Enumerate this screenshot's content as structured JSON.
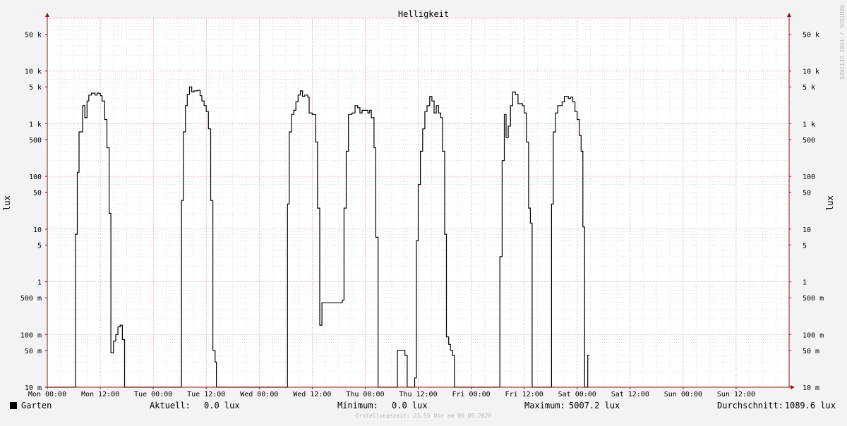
{
  "chart_data": {
    "type": "line",
    "title": "Helligkeit",
    "ylabel": "lux",
    "y_scale": "log",
    "ylim": [
      0.01,
      100000
    ],
    "y_ticks": [
      {
        "value": 50000,
        "label": "50 k"
      },
      {
        "value": 10000,
        "label": "10 k"
      },
      {
        "value": 5000,
        "label": "5 k"
      },
      {
        "value": 1000,
        "label": "1 k"
      },
      {
        "value": 500,
        "label": "500"
      },
      {
        "value": 100,
        "label": "100"
      },
      {
        "value": 50,
        "label": "50"
      },
      {
        "value": 10,
        "label": "10"
      },
      {
        "value": 5,
        "label": "5"
      },
      {
        "value": 1,
        "label": "1"
      },
      {
        "value": 0.5,
        "label": "500 m"
      },
      {
        "value": 0.1,
        "label": "100 m"
      },
      {
        "value": 0.05,
        "label": "50 m"
      },
      {
        "value": 0.01,
        "label": "10 m"
      }
    ],
    "xlim": [
      0,
      168
    ],
    "x_unit": "hours since Mon 00:00",
    "x_ticks": [
      {
        "value": 0,
        "label": "Mon 00:00"
      },
      {
        "value": 12,
        "label": "Mon 12:00"
      },
      {
        "value": 24,
        "label": "Tue 00:00"
      },
      {
        "value": 36,
        "label": "Tue 12:00"
      },
      {
        "value": 48,
        "label": "Wed 00:00"
      },
      {
        "value": 60,
        "label": "Wed 12:00"
      },
      {
        "value": 72,
        "label": "Thu 00:00"
      },
      {
        "value": 84,
        "label": "Thu 12:00"
      },
      {
        "value": 96,
        "label": "Fri 00:00"
      },
      {
        "value": 108,
        "label": "Fri 12:00"
      },
      {
        "value": 120,
        "label": "Sat 00:00"
      },
      {
        "value": 132,
        "label": "Sat 12:00"
      },
      {
        "value": 144,
        "label": "Sun 00:00"
      },
      {
        "value": 156,
        "label": "Sun 12:00"
      }
    ],
    "grid": true,
    "legend": "bottom-left",
    "series": [
      {
        "name": "Garten",
        "color": "#000000",
        "points": [
          [
            0,
            0.01
          ],
          [
            6.4,
            0.01
          ],
          [
            6.4,
            8
          ],
          [
            6.8,
            8
          ],
          [
            6.8,
            120
          ],
          [
            7.2,
            120
          ],
          [
            7.2,
            700
          ],
          [
            7.6,
            700
          ],
          [
            7.6,
            700
          ],
          [
            8.0,
            700
          ],
          [
            8.0,
            2200
          ],
          [
            8.5,
            2200
          ],
          [
            8.5,
            1300
          ],
          [
            9.0,
            1300
          ],
          [
            9.0,
            2700
          ],
          [
            9.4,
            2700
          ],
          [
            9.4,
            3500
          ],
          [
            10.0,
            3500
          ],
          [
            10.0,
            3800
          ],
          [
            10.8,
            3800
          ],
          [
            10.8,
            3500
          ],
          [
            11.3,
            3500
          ],
          [
            11.3,
            3800
          ],
          [
            12.0,
            3800
          ],
          [
            12.0,
            3400
          ],
          [
            12.4,
            3400
          ],
          [
            12.4,
            2700
          ],
          [
            13.0,
            2700
          ],
          [
            13.0,
            1200
          ],
          [
            13.5,
            1200
          ],
          [
            13.5,
            350
          ],
          [
            14.0,
            350
          ],
          [
            14.0,
            20
          ],
          [
            14.4,
            20
          ],
          [
            14.4,
            0.045
          ],
          [
            15.0,
            0.045
          ],
          [
            15.0,
            0.075
          ],
          [
            15.5,
            0.075
          ],
          [
            15.5,
            0.1
          ],
          [
            16.0,
            0.1
          ],
          [
            16.0,
            0.14
          ],
          [
            16.5,
            0.14
          ],
          [
            16.5,
            0.15
          ],
          [
            17.0,
            0.15
          ],
          [
            17.0,
            0.08
          ],
          [
            17.5,
            0.08
          ],
          [
            17.5,
            0.01
          ],
          [
            18.0,
            0.01
          ],
          [
            30.4,
            0.01
          ],
          [
            30.4,
            35
          ],
          [
            30.8,
            35
          ],
          [
            30.8,
            700
          ],
          [
            31.3,
            700
          ],
          [
            31.3,
            2200
          ],
          [
            31.7,
            2200
          ],
          [
            31.7,
            3600
          ],
          [
            32.2,
            3600
          ],
          [
            32.2,
            5000
          ],
          [
            32.7,
            5000
          ],
          [
            32.7,
            4000
          ],
          [
            33.2,
            4000
          ],
          [
            33.2,
            4200
          ],
          [
            34.0,
            4200
          ],
          [
            34.0,
            4300
          ],
          [
            34.6,
            4300
          ],
          [
            34.6,
            3400
          ],
          [
            35.0,
            3400
          ],
          [
            35.0,
            2700
          ],
          [
            35.5,
            2700
          ],
          [
            35.5,
            2200
          ],
          [
            36.0,
            2200
          ],
          [
            36.0,
            1700
          ],
          [
            36.5,
            1700
          ],
          [
            36.5,
            800
          ],
          [
            37.0,
            800
          ],
          [
            37.0,
            35
          ],
          [
            37.5,
            35
          ],
          [
            37.5,
            0.05
          ],
          [
            38.0,
            0.05
          ],
          [
            38.0,
            0.03
          ],
          [
            38.3,
            0.03
          ],
          [
            38.3,
            0.01
          ],
          [
            54.4,
            0.01
          ],
          [
            54.4,
            30
          ],
          [
            54.8,
            30
          ],
          [
            54.8,
            700
          ],
          [
            55.3,
            700
          ],
          [
            55.3,
            1500
          ],
          [
            55.8,
            1500
          ],
          [
            55.8,
            1800
          ],
          [
            56.3,
            1800
          ],
          [
            56.3,
            2600
          ],
          [
            56.8,
            2600
          ],
          [
            56.8,
            3500
          ],
          [
            57.3,
            3500
          ],
          [
            57.3,
            4200
          ],
          [
            57.8,
            4200
          ],
          [
            57.8,
            3300
          ],
          [
            58.3,
            3300
          ],
          [
            58.3,
            3500
          ],
          [
            59.0,
            3500
          ],
          [
            59.0,
            3200
          ],
          [
            59.3,
            3200
          ],
          [
            59.3,
            1600
          ],
          [
            60.0,
            1600
          ],
          [
            60.0,
            1500
          ],
          [
            60.8,
            1500
          ],
          [
            60.8,
            450
          ],
          [
            61.2,
            450
          ],
          [
            61.2,
            25
          ],
          [
            61.7,
            25
          ],
          [
            61.7,
            0.15
          ],
          [
            62.2,
            0.15
          ],
          [
            62.2,
            0.4
          ],
          [
            65.4,
            0.4
          ],
          [
            65.4,
            0.4
          ],
          [
            66.2,
            0.4
          ],
          [
            66.2,
            0.4
          ],
          [
            66.8,
            0.4
          ],
          [
            66.8,
            0.45
          ],
          [
            67.2,
            0.45
          ],
          [
            67.2,
            25
          ],
          [
            67.7,
            25
          ],
          [
            67.7,
            300
          ],
          [
            68.2,
            300
          ],
          [
            68.2,
            1500
          ],
          [
            69.0,
            1500
          ],
          [
            69.0,
            1600
          ],
          [
            69.7,
            1600
          ],
          [
            69.7,
            2200
          ],
          [
            70.3,
            2200
          ],
          [
            70.3,
            2000
          ],
          [
            70.8,
            2000
          ],
          [
            70.8,
            1600
          ],
          [
            71.3,
            1600
          ],
          [
            71.3,
            1800
          ],
          [
            72.6,
            1800
          ],
          [
            72.6,
            1600
          ],
          [
            73.0,
            1600
          ],
          [
            73.0,
            1800
          ],
          [
            73.4,
            1800
          ],
          [
            73.4,
            1300
          ],
          [
            74.0,
            1300
          ],
          [
            74.0,
            350
          ],
          [
            74.4,
            350
          ],
          [
            74.4,
            7
          ],
          [
            74.9,
            7
          ],
          [
            74.9,
            0.01
          ],
          [
            79.3,
            0.01
          ],
          [
            79.3,
            0.05
          ],
          [
            81.0,
            0.05
          ],
          [
            81.0,
            0.04
          ],
          [
            81.5,
            0.04
          ],
          [
            81.5,
            0.01
          ],
          [
            83.2,
            0.01
          ],
          [
            83.2,
            0.015
          ],
          [
            83.6,
            0.015
          ],
          [
            83.6,
            6
          ],
          [
            84.0,
            6
          ],
          [
            84.0,
            70
          ],
          [
            84.5,
            70
          ],
          [
            84.5,
            300
          ],
          [
            85.0,
            300
          ],
          [
            85.0,
            800
          ],
          [
            85.5,
            800
          ],
          [
            85.5,
            1700
          ],
          [
            86.0,
            1700
          ],
          [
            86.0,
            2200
          ],
          [
            86.6,
            2200
          ],
          [
            86.6,
            3300
          ],
          [
            87.1,
            3300
          ],
          [
            87.1,
            2700
          ],
          [
            87.6,
            2700
          ],
          [
            87.6,
            1600
          ],
          [
            88.1,
            1600
          ],
          [
            88.1,
            2200
          ],
          [
            88.6,
            2200
          ],
          [
            88.6,
            1600
          ],
          [
            89.1,
            1600
          ],
          [
            89.1,
            1300
          ],
          [
            89.5,
            1300
          ],
          [
            89.5,
            300
          ],
          [
            90.0,
            300
          ],
          [
            90.0,
            8
          ],
          [
            90.4,
            8
          ],
          [
            90.4,
            0.09
          ],
          [
            90.9,
            0.09
          ],
          [
            90.9,
            0.065
          ],
          [
            91.3,
            0.065
          ],
          [
            91.3,
            0.05
          ],
          [
            91.8,
            0.05
          ],
          [
            91.8,
            0.04
          ],
          [
            92.2,
            0.04
          ],
          [
            92.2,
            0.01
          ],
          [
            102.5,
            0.01
          ],
          [
            102.5,
            3
          ],
          [
            103.0,
            3
          ],
          [
            103.0,
            200
          ],
          [
            103.5,
            200
          ],
          [
            103.5,
            1500
          ],
          [
            103.9,
            1500
          ],
          [
            103.9,
            550
          ],
          [
            104.4,
            550
          ],
          [
            104.4,
            900
          ],
          [
            104.9,
            900
          ],
          [
            104.9,
            2200
          ],
          [
            105.4,
            2200
          ],
          [
            105.4,
            4000
          ],
          [
            106.0,
            4000
          ],
          [
            106.0,
            3600
          ],
          [
            106.6,
            3600
          ],
          [
            106.6,
            2400
          ],
          [
            107.6,
            2400
          ],
          [
            107.6,
            2200
          ],
          [
            108.0,
            2200
          ],
          [
            108.0,
            1600
          ],
          [
            108.5,
            1600
          ],
          [
            108.5,
            450
          ],
          [
            109.0,
            450
          ],
          [
            109.0,
            25
          ],
          [
            109.4,
            25
          ],
          [
            109.4,
            13
          ],
          [
            109.8,
            13
          ],
          [
            109.8,
            0.01
          ],
          [
            114.2,
            0.01
          ],
          [
            114.2,
            30
          ],
          [
            114.6,
            30
          ],
          [
            114.6,
            700
          ],
          [
            115.1,
            700
          ],
          [
            115.1,
            1600
          ],
          [
            115.6,
            1600
          ],
          [
            115.6,
            2200
          ],
          [
            116.6,
            2200
          ],
          [
            116.6,
            2600
          ],
          [
            117.1,
            2600
          ],
          [
            117.1,
            3300
          ],
          [
            118.0,
            3300
          ],
          [
            118.0,
            3000
          ],
          [
            118.5,
            3000
          ],
          [
            118.5,
            3200
          ],
          [
            119.0,
            3200
          ],
          [
            119.0,
            2600
          ],
          [
            119.5,
            2600
          ],
          [
            119.5,
            1700
          ],
          [
            120.0,
            1700
          ],
          [
            120.0,
            1200
          ],
          [
            120.5,
            1200
          ],
          [
            120.5,
            600
          ],
          [
            120.9,
            600
          ],
          [
            120.9,
            300
          ],
          [
            121.3,
            300
          ],
          [
            121.3,
            11
          ],
          [
            121.7,
            11
          ],
          [
            121.7,
            0.01
          ],
          [
            122.4,
            0.01
          ],
          [
            122.4,
            0.04
          ],
          [
            122.8,
            0.04
          ]
        ]
      }
    ],
    "legend_stats": {
      "current_label": "Aktuell:",
      "current_value": "0.0 lux",
      "min_label": "Minimum:",
      "min_value": "0.0 lux",
      "max_label": "Maximum:",
      "max_value": "5007.2 lux",
      "avg_label": "Durchschnitt:",
      "avg_value": "1089.6 lux"
    },
    "watermark": "RRDTOOL / TOBI OETIKER",
    "footer": "Erstellungszeit: 23:55 Uhr am 06.09.2020"
  },
  "colors": {
    "background": "#f3f3f3",
    "canvas": "#ffffff",
    "grid_major": "#e8a0a0",
    "grid_minor": "#c8c8c8",
    "axis": "#8b1a1a",
    "line": "#000000",
    "text": "#000000",
    "muted": "#bbbbbb"
  }
}
